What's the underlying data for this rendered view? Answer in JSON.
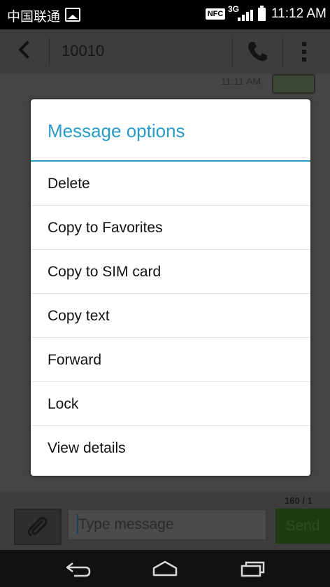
{
  "status_bar": {
    "carrier": "中国联通",
    "nfc": "NFC",
    "network": "3G",
    "time": "11:12 AM"
  },
  "header": {
    "title": "10010",
    "back_icon": "chevron-left-icon",
    "call_icon": "phone-icon",
    "menu_icon": "overflow-menu-icon"
  },
  "conversation": {
    "last_message_time": "11:11 AM"
  },
  "compose": {
    "char_counter": "160 / 1",
    "placeholder": "Type message",
    "send_label": "Send",
    "attach_icon": "paperclip-icon"
  },
  "dialog": {
    "title": "Message options",
    "options": [
      "Delete",
      "Copy to Favorites",
      "Copy to SIM card",
      "Copy text",
      "Forward",
      "Lock",
      "View details"
    ]
  },
  "nav": {
    "back_icon": "nav-back-icon",
    "home_icon": "nav-home-icon",
    "recents_icon": "nav-recents-icon"
  },
  "colors": {
    "accent": "#2a9bc7",
    "send_green": "#1d3a10"
  }
}
